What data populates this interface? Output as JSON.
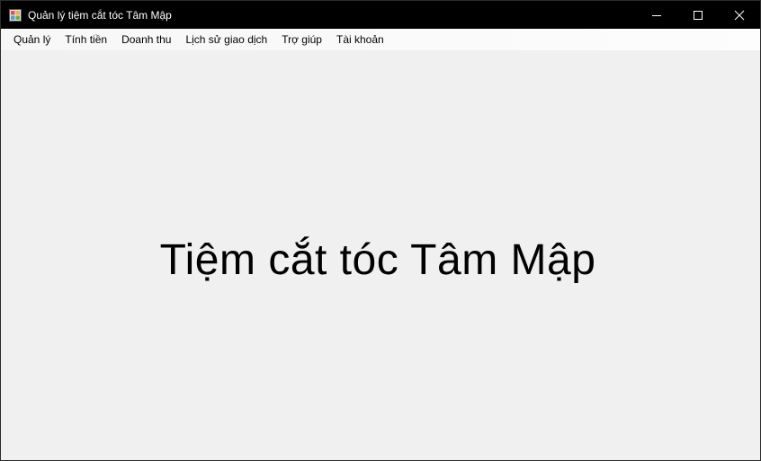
{
  "window": {
    "title": "Quản lý tiệm cắt tóc Tâm Mập",
    "icon": "app-window-icon"
  },
  "caption": {
    "minimize_icon": "minimize-icon",
    "maximize_icon": "maximize-icon",
    "close_icon": "close-icon"
  },
  "menu": {
    "items": [
      {
        "label": "Quản lý"
      },
      {
        "label": "Tính tiền"
      },
      {
        "label": "Doanh thu"
      },
      {
        "label": "Lịch sử giao dịch"
      },
      {
        "label": "Trợ giúp"
      },
      {
        "label": "Tài khoản"
      }
    ]
  },
  "main": {
    "heading": "Tiệm cắt tóc Tâm Mập"
  },
  "colors": {
    "titlebar": "#000000",
    "background": "#f0f0f0",
    "menubar": "#f9f9f9"
  }
}
